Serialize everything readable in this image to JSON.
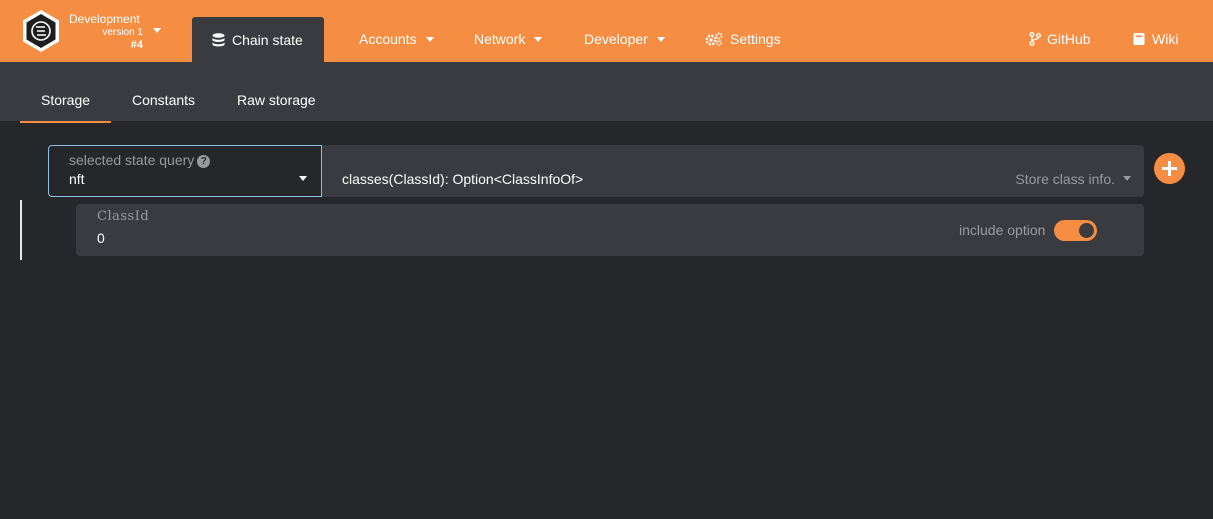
{
  "header": {
    "chain_name": "Development",
    "chain_version": "version 1",
    "chain_block": "#4",
    "active_tab": "Chain state",
    "nav": [
      {
        "label": "Accounts"
      },
      {
        "label": "Network"
      },
      {
        "label": "Developer"
      },
      {
        "label": "Settings"
      }
    ],
    "links": [
      {
        "label": "GitHub"
      },
      {
        "label": "Wiki"
      }
    ]
  },
  "subtabs": {
    "items": [
      {
        "label": "Storage",
        "active": true
      },
      {
        "label": "Constants"
      },
      {
        "label": "Raw storage"
      }
    ]
  },
  "query": {
    "section_label": "selected state query",
    "section_value": "nft",
    "method_value": "classes(ClassId): Option<ClassInfoOf>",
    "method_description": "Store class info."
  },
  "param": {
    "label": "ClassId",
    "value": "0",
    "include_option_label": "include option",
    "include_option_enabled": true
  },
  "colors": {
    "accent": "#f58e42",
    "background": "#26272b",
    "panel": "#3a3b40"
  }
}
